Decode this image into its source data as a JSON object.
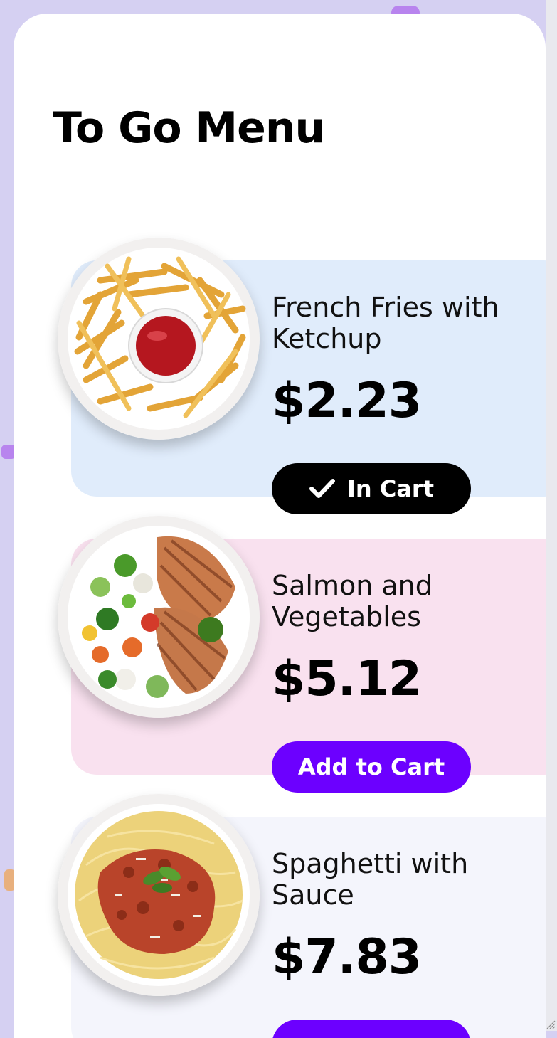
{
  "menu": {
    "title": "To Go Menu",
    "items": [
      {
        "name": "French Fries with Ketchup",
        "price": "$2.23",
        "button_label": "In Cart",
        "button_state": "in-cart",
        "button_icon": "check-icon",
        "accent_bg": "#e0ecfb",
        "plate_icon": "french-fries-image"
      },
      {
        "name": "Salmon and Vegetables",
        "price": "$5.12",
        "button_label": "Add to Cart",
        "button_state": "add",
        "accent_bg": "#f9e1ef",
        "plate_icon": "salmon-vegetables-image"
      },
      {
        "name": "Spaghetti with Sauce",
        "price": "$7.83",
        "button_label": "",
        "button_state": "add",
        "accent_bg": "#f4f5fc",
        "plate_icon": "spaghetti-image"
      }
    ]
  },
  "colors": {
    "page_bg": "#d5d0f2",
    "card_bg": "#ffffff",
    "in_cart_button": "#000000",
    "add_button": "#6c00ff"
  }
}
